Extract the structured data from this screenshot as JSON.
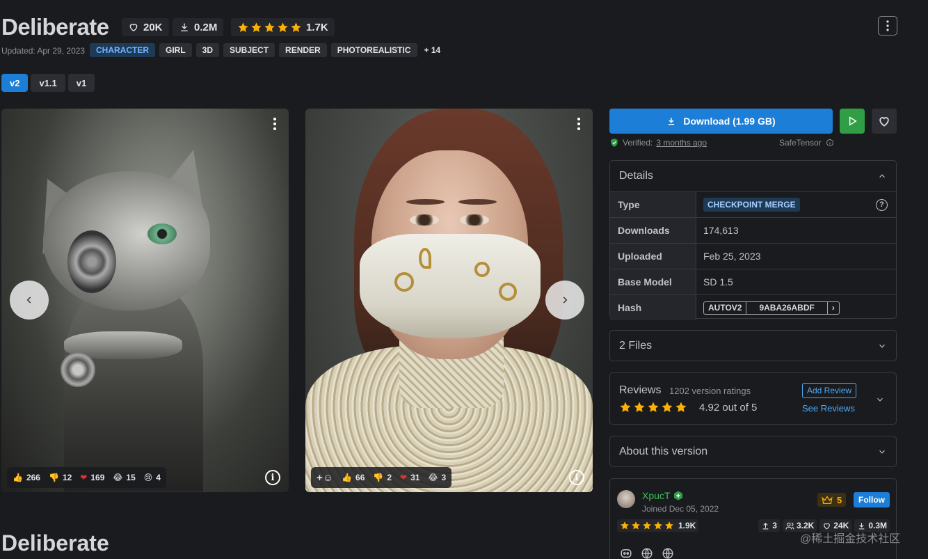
{
  "header": {
    "title": "Deliberate",
    "favorites": "20K",
    "downloads": "0.2M",
    "rating_count": "1.7K",
    "rating_stars": 5,
    "updated": "Updated: Apr 29, 2023",
    "tags": [
      "CHARACTER",
      "GIRL",
      "3D",
      "SUBJECT",
      "RENDER",
      "PHOTOREALISTIC"
    ],
    "more_tags": "+ 14"
  },
  "versions": [
    "v2",
    "v1.1",
    "v1"
  ],
  "gallery": {
    "card1": {
      "reactions": [
        {
          "icon": "thumbs-up-icon",
          "glyph": "👍",
          "count": "266"
        },
        {
          "icon": "thumbs-down-icon",
          "glyph": "👎",
          "count": "12"
        },
        {
          "icon": "heart-icon",
          "glyph": "❤",
          "count": "169"
        },
        {
          "icon": "laugh-icon",
          "glyph": "😂",
          "count": "15"
        },
        {
          "icon": "cry-icon",
          "glyph": "😢",
          "count": "4"
        }
      ]
    },
    "card2": {
      "reactions": [
        {
          "icon": "thumbs-up-icon",
          "glyph": "👍",
          "count": "66"
        },
        {
          "icon": "thumbs-down-icon",
          "glyph": "👎",
          "count": "2"
        },
        {
          "icon": "heart-icon",
          "glyph": "❤",
          "count": "31"
        },
        {
          "icon": "laugh-icon",
          "glyph": "😂",
          "count": "3"
        }
      ]
    }
  },
  "download": {
    "label": "Download (1.99 GB)",
    "verified_prefix": "Verified:",
    "verified_link": "3 months ago",
    "safetensor": "SafeTensor"
  },
  "details": {
    "heading": "Details",
    "rows": {
      "type_label": "Type",
      "type_value": "CHECKPOINT MERGE",
      "downloads_label": "Downloads",
      "downloads_value": "174,613",
      "uploaded_label": "Uploaded",
      "uploaded_value": "Feb 25, 2023",
      "base_label": "Base Model",
      "base_value": "SD 1.5",
      "hash_label": "Hash",
      "hash_type": "AUTOV2",
      "hash_value": "9ABA26ABDF"
    }
  },
  "files": {
    "heading": "2 Files"
  },
  "reviews": {
    "heading": "Reviews",
    "count": "1202 version ratings",
    "score": "4.92 out of 5",
    "add": "Add Review",
    "see": "See Reviews"
  },
  "about": {
    "heading": "About this version"
  },
  "creator": {
    "name": "XpucT",
    "joined": "Joined Dec 05, 2022",
    "rank": "5",
    "follow": "Follow",
    "rating": "1.9K",
    "uploads": "3",
    "followers": "3.2K",
    "favorites": "24K",
    "downloads": "0.3M"
  },
  "bottom_title": "Deliberate",
  "watermark": "@稀土掘金技术社区",
  "colors": {
    "accent": "#1c7ed6",
    "star": "#fab005",
    "success": "#2f9e44",
    "link": "#4dabf7"
  }
}
